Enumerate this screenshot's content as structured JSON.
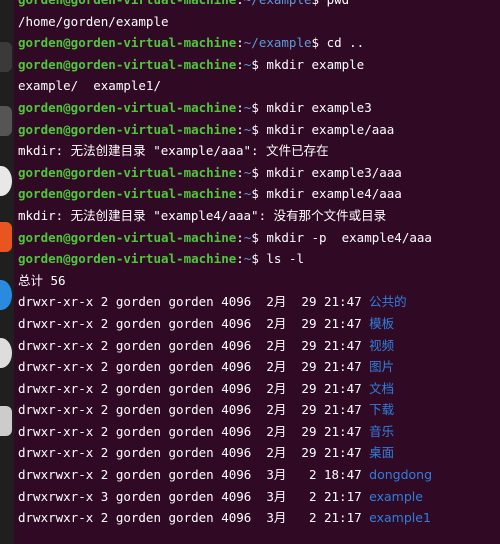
{
  "terminal": {
    "lines": [
      {
        "type": "prompt",
        "user": "gorden@gorden-virtual-machine",
        "path": "~/example",
        "sym": "$",
        "cmd": " pwd"
      },
      {
        "type": "output",
        "text": "/home/gorden/example"
      },
      {
        "type": "prompt",
        "user": "gorden@gorden-virtual-machine",
        "path": "~/example",
        "sym": "$",
        "cmd": " cd .."
      },
      {
        "type": "prompt",
        "user": "gorden@gorden-virtual-machine",
        "path": "~",
        "sym": "$",
        "cmd": " mkdir example"
      },
      {
        "type": "output",
        "text": "example/  example1/"
      },
      {
        "type": "prompt",
        "user": "gorden@gorden-virtual-machine",
        "path": "~",
        "sym": "$",
        "cmd": " mkdir example3"
      },
      {
        "type": "prompt",
        "user": "gorden@gorden-virtual-machine",
        "path": "~",
        "sym": "$",
        "cmd": " mkdir example/aaa"
      },
      {
        "type": "output",
        "text": "mkdir: 无法创建目录 \"example/aaa\": 文件已存在"
      },
      {
        "type": "prompt",
        "user": "gorden@gorden-virtual-machine",
        "path": "~",
        "sym": "$",
        "cmd": " mkdir example3/aaa"
      },
      {
        "type": "prompt",
        "user": "gorden@gorden-virtual-machine",
        "path": "~",
        "sym": "$",
        "cmd": " mkdir example4/aaa"
      },
      {
        "type": "output",
        "text": "mkdir: 无法创建目录 \"example4/aaa\": 没有那个文件或目录"
      },
      {
        "type": "prompt",
        "user": "gorden@gorden-virtual-machine",
        "path": "~",
        "sym": "$",
        "cmd": " mkdir -p  example4/aaa"
      },
      {
        "type": "prompt",
        "user": "gorden@gorden-virtual-machine",
        "path": "~",
        "sym": "$",
        "cmd": " ls -l"
      },
      {
        "type": "output",
        "text": "总计 56"
      },
      {
        "type": "listing",
        "meta": "drwxr-xr-x 2 gorden gorden 4096  2月  29 21:47 ",
        "name": "公共的"
      },
      {
        "type": "listing",
        "meta": "drwxr-xr-x 2 gorden gorden 4096  2月  29 21:47 ",
        "name": "模板"
      },
      {
        "type": "listing",
        "meta": "drwxr-xr-x 2 gorden gorden 4096  2月  29 21:47 ",
        "name": "视频"
      },
      {
        "type": "listing",
        "meta": "drwxr-xr-x 2 gorden gorden 4096  2月  29 21:47 ",
        "name": "图片"
      },
      {
        "type": "listing",
        "meta": "drwxr-xr-x 2 gorden gorden 4096  2月  29 21:47 ",
        "name": "文档"
      },
      {
        "type": "listing",
        "meta": "drwxr-xr-x 2 gorden gorden 4096  2月  29 21:47 ",
        "name": "下载"
      },
      {
        "type": "listing",
        "meta": "drwxr-xr-x 2 gorden gorden 4096  2月  29 21:47 ",
        "name": "音乐"
      },
      {
        "type": "listing",
        "meta": "drwxr-xr-x 2 gorden gorden 4096  2月  29 21:47 ",
        "name": "桌面"
      },
      {
        "type": "listing",
        "meta": "drwxrwxr-x 2 gorden gorden 4096  3月   2 18:47 ",
        "name": "dongdong"
      },
      {
        "type": "listing",
        "meta": "drwxrwxr-x 3 gorden gorden 4096  3月   2 21:17 ",
        "name": "example"
      },
      {
        "type": "listing",
        "meta": "drwxrwxr-x 2 gorden gorden 4096  3月   2 21:17 ",
        "name": "example1"
      }
    ]
  },
  "dock": {
    "icons": [
      {
        "name": "files-icon",
        "color": "#3a3a3a"
      },
      {
        "name": "app-icon",
        "color": "#555555"
      },
      {
        "name": "rhythmbox-icon",
        "color": "#e8e8e8"
      },
      {
        "name": "software-icon",
        "color": "#e95420"
      },
      {
        "name": "help-icon",
        "color": "#2a8ae0"
      },
      {
        "name": "disc-icon",
        "color": "#dddddd"
      },
      {
        "name": "trash-icon",
        "color": "#cccccc"
      }
    ]
  },
  "colors": {
    "background": "#300a24",
    "user": "#4ec83a",
    "path": "#5c9ad8",
    "directory": "#2f7fde"
  }
}
